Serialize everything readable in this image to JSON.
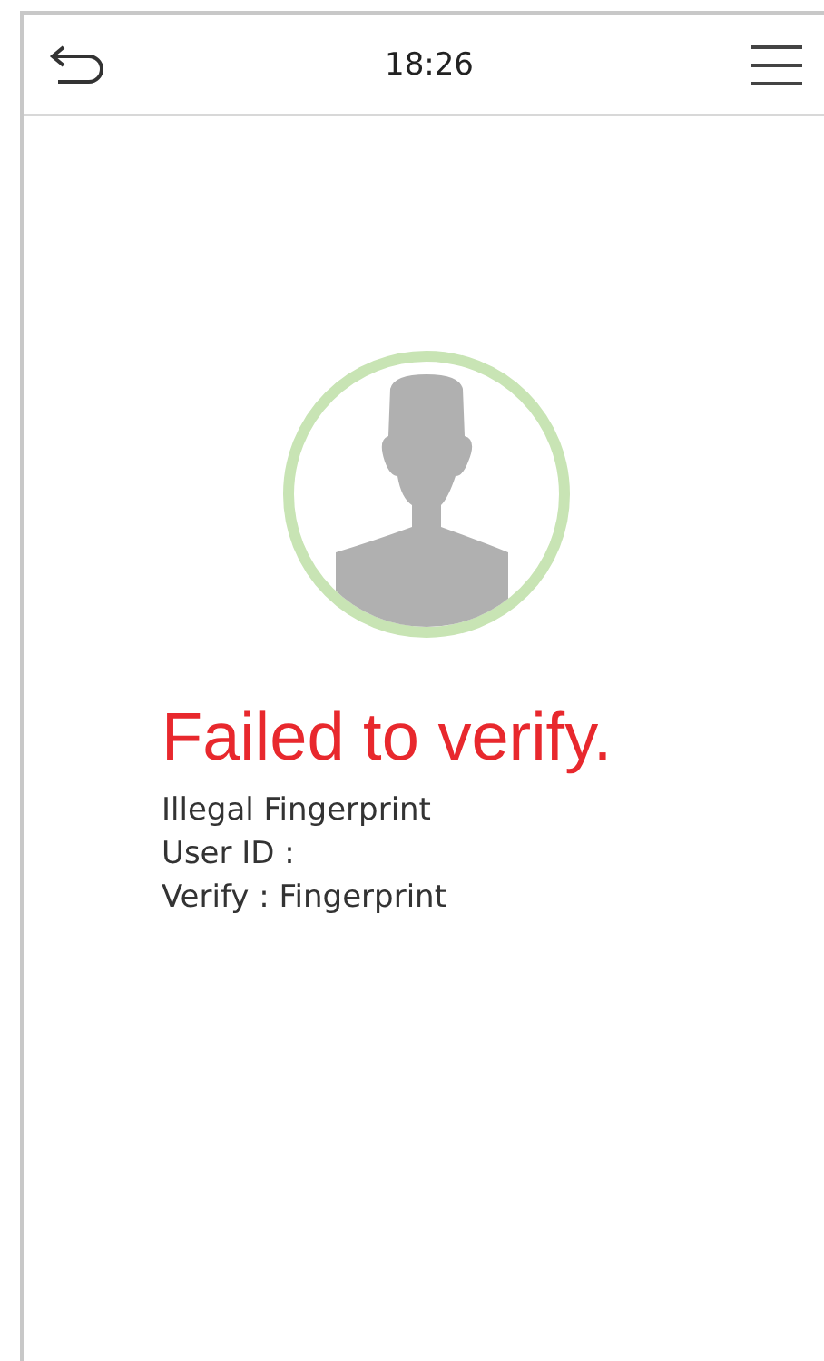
{
  "header": {
    "time": "18:26"
  },
  "result": {
    "title": "Failed to verify.",
    "lines": [
      "Illegal Fingerprint",
      "User ID :",
      "Verify : Fingerprint"
    ]
  }
}
